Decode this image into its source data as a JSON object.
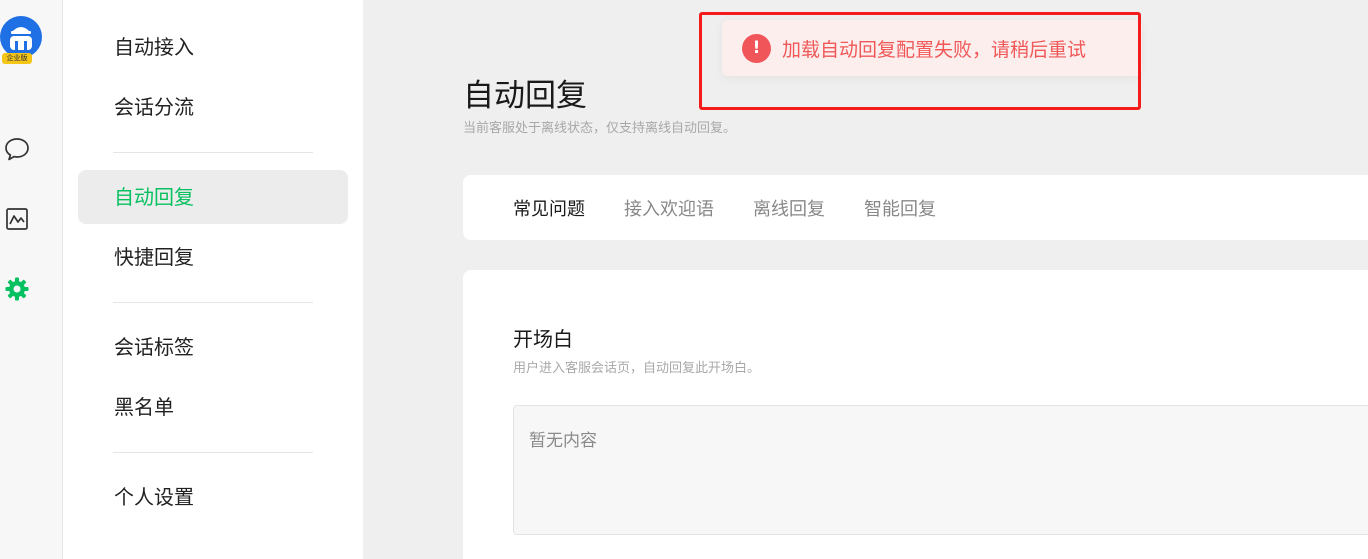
{
  "rail": {
    "logo_badge": "企业版",
    "icons": [
      "chat-bubble-icon",
      "monitor-chart-icon",
      "gear-icon"
    ],
    "accent_color": "#07c160",
    "logo_color": "#1f6fe5"
  },
  "menu": {
    "items": [
      {
        "label": "自动接入"
      },
      {
        "label": "会话分流"
      },
      {
        "label": "自动回复",
        "active": true
      },
      {
        "label": "快捷回复"
      },
      {
        "label": "会话标签"
      },
      {
        "label": "黑名单"
      },
      {
        "label": "个人设置"
      }
    ]
  },
  "page": {
    "title": "自动回复",
    "subtitle": "当前客服处于离线状态，仅支持离线自动回复。"
  },
  "tabs": [
    {
      "label": "常见问题",
      "active": true
    },
    {
      "label": "接入欢迎语"
    },
    {
      "label": "离线回复"
    },
    {
      "label": "智能回复"
    }
  ],
  "panel": {
    "title": "开场白",
    "subtitle": "用户进入客服会话页，自动回复此开场白。",
    "empty_text": "暂无内容"
  },
  "toast": {
    "icon": "!",
    "message": "加载自动回复配置失败，请稍后重试",
    "color": "#f05858",
    "highlight_color": "#f41b1b"
  }
}
